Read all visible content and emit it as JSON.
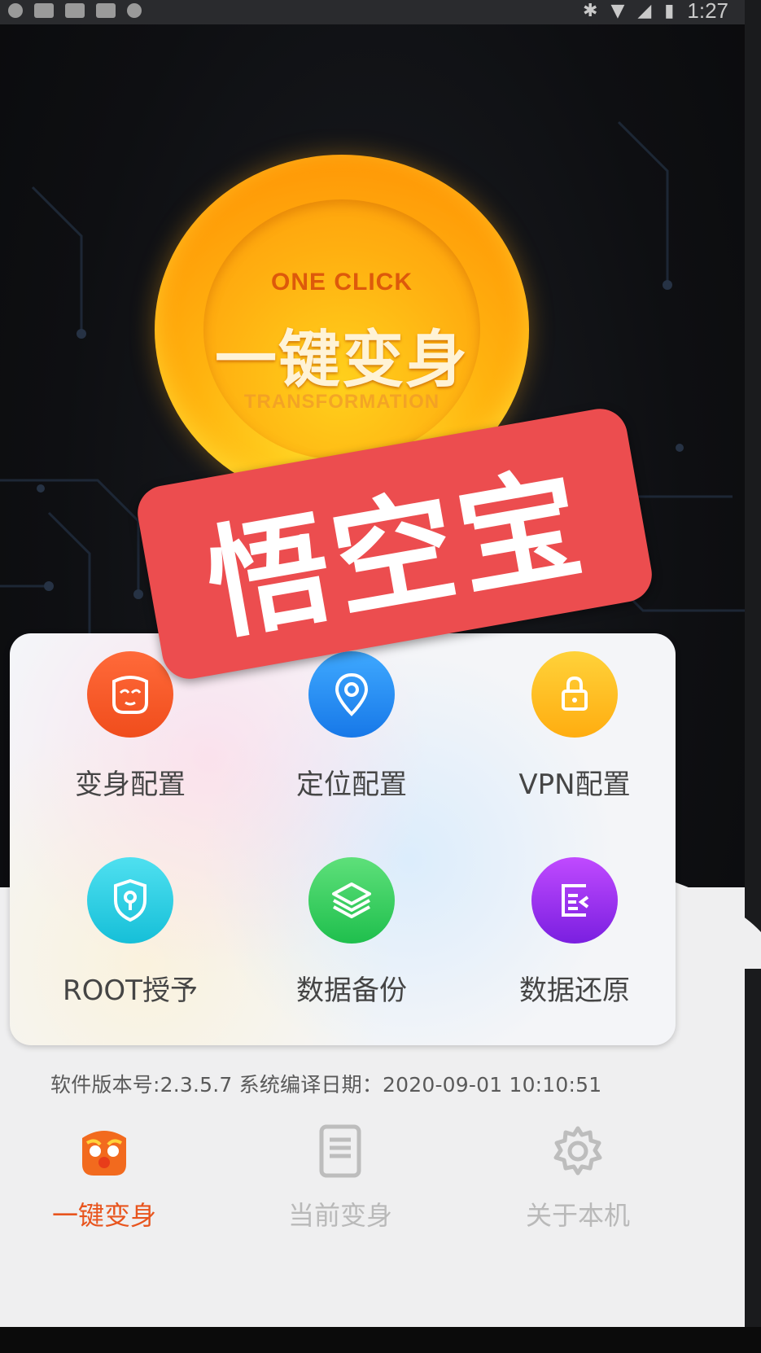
{
  "status_bar": {
    "time": "1:27"
  },
  "hero": {
    "top_text": "ONE CLICK",
    "main_text": "一键变身",
    "bottom_text": "TRANSFORMATION"
  },
  "watermark": {
    "text": "悟空宝"
  },
  "menu": {
    "items": [
      {
        "label": "变身配置",
        "icon": "mask-icon",
        "color": "#f04d1c"
      },
      {
        "label": "定位配置",
        "icon": "location-gear-icon",
        "color": "#1778e8"
      },
      {
        "label": "VPN配置",
        "icon": "vpn-lock-icon",
        "color": "#ffad10"
      },
      {
        "label": "ROOT授予",
        "icon": "shield-key-icon",
        "color": "#16bfd8"
      },
      {
        "label": "数据备份",
        "icon": "layers-icon",
        "color": "#1fbf4d"
      },
      {
        "label": "数据还原",
        "icon": "restore-doc-icon",
        "color": "#7a1fe0"
      }
    ]
  },
  "version_text": "软件版本号:2.3.5.7 系统编译日期：2020-09-01 10:10:51",
  "bottom_nav": {
    "items": [
      {
        "label": "一键变身",
        "icon": "face-icon",
        "active": true
      },
      {
        "label": "当前变身",
        "icon": "document-icon",
        "active": false
      },
      {
        "label": "关于本机",
        "icon": "gear-icon",
        "active": false
      }
    ]
  },
  "colors": {
    "accent": "#e8551e",
    "watermark": "#ec4d4f",
    "hero_orange": "#ffb30f"
  }
}
